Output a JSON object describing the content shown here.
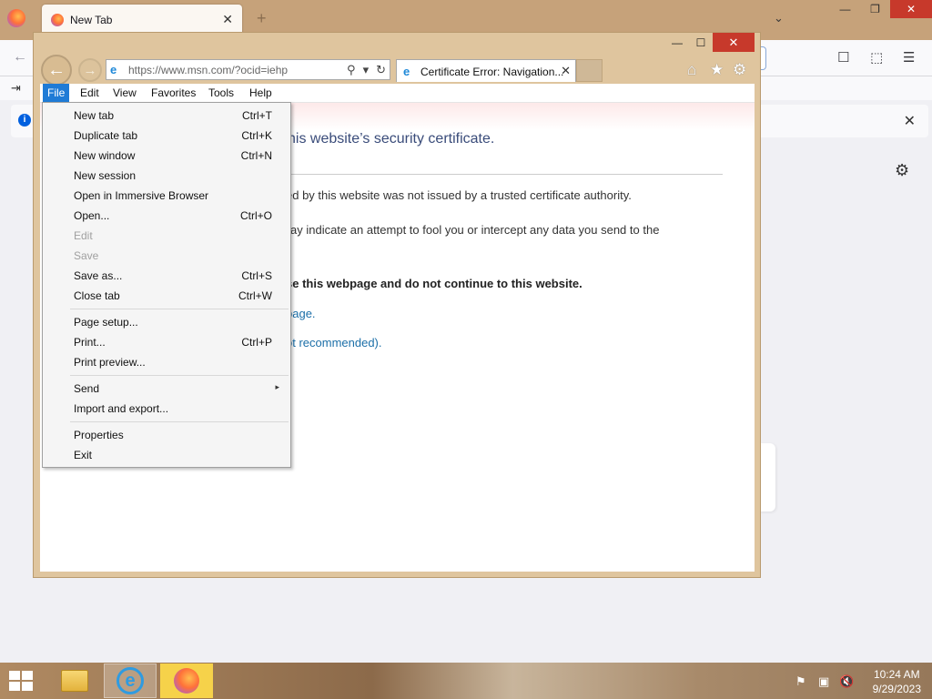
{
  "firefox": {
    "tab_title": "New Tab",
    "new_tab_symbol": "+",
    "close_symbol": "✕",
    "list_all_symbol": "⌄",
    "window_controls": [
      "—",
      "❐",
      "✕"
    ],
    "back_symbol": "←",
    "toolbar_icons": [
      "pocket-icon",
      "extensions-icon",
      "menu-icon"
    ],
    "toolbar_glyphs": [
      "☐",
      "⬚",
      "☰"
    ],
    "signin_symbol": "⇥",
    "info_symbol": "i",
    "gear_symbol": "⚙"
  },
  "ie": {
    "window_controls": [
      "—",
      "☐",
      "✕"
    ],
    "back_symbol": "←",
    "forward_symbol": "→",
    "address": {
      "icon": "e",
      "url": "https://www.msn.com/?ocid=iehp",
      "search_symbol": "⚲",
      "dropdown_symbol": "▾",
      "refresh_symbol": "↻"
    },
    "tab": {
      "icon": "e",
      "title": "Certificate Error: Navigation...",
      "close_symbol": "✕"
    },
    "tools": {
      "home": "⌂",
      "favorites": "★",
      "settings": "⚙"
    },
    "menubar": [
      "File",
      "Edit",
      "View",
      "Favorites",
      "Tools",
      "Help"
    ],
    "page": {
      "title_fragment": "his website’s security certificate.",
      "line1": "ed by this website was not issued by a trusted certificate authority.",
      "line2": "ay indicate an attempt to fool you or intercept any data you send to the",
      "bold_line": "se this webpage and do not continue to this website.",
      "link1": "bage.",
      "link2": "ot recommended)."
    }
  },
  "file_menu": {
    "items": [
      {
        "label": "New tab",
        "shortcut": "Ctrl+T",
        "disabled": false
      },
      {
        "label": "Duplicate tab",
        "shortcut": "Ctrl+K",
        "disabled": false
      },
      {
        "label": "New window",
        "shortcut": "Ctrl+N",
        "disabled": false
      },
      {
        "label": "New session",
        "shortcut": "",
        "disabled": false
      },
      {
        "label": "Open in Immersive Browser",
        "shortcut": "",
        "disabled": false
      },
      {
        "label": "Open...",
        "shortcut": "Ctrl+O",
        "disabled": false
      },
      {
        "label": "Edit",
        "shortcut": "",
        "disabled": true
      },
      {
        "label": "Save",
        "shortcut": "",
        "disabled": true
      },
      {
        "label": "Save as...",
        "shortcut": "Ctrl+S",
        "disabled": false
      },
      {
        "label": "Close tab",
        "shortcut": "Ctrl+W",
        "disabled": false
      },
      {
        "label": "Page setup...",
        "shortcut": "",
        "disabled": false
      },
      {
        "label": "Print...",
        "shortcut": "Ctrl+P",
        "disabled": false
      },
      {
        "label": "Print preview...",
        "shortcut": "",
        "disabled": false
      },
      {
        "label": "Send",
        "shortcut": "",
        "disabled": false,
        "submenu_symbol": "▸"
      },
      {
        "label": "Import and export...",
        "shortcut": "",
        "disabled": false
      },
      {
        "label": "Properties",
        "shortcut": "",
        "disabled": false
      },
      {
        "label": "Exit",
        "shortcut": "",
        "disabled": false
      }
    ]
  },
  "taskbar": {
    "apps": [
      "file-explorer",
      "internet-explorer",
      "firefox"
    ],
    "ie_glyph": "e",
    "tray": [
      "⚑",
      "▣",
      "🔇"
    ],
    "time": "10:24 AM",
    "date": "9/29/2023"
  }
}
